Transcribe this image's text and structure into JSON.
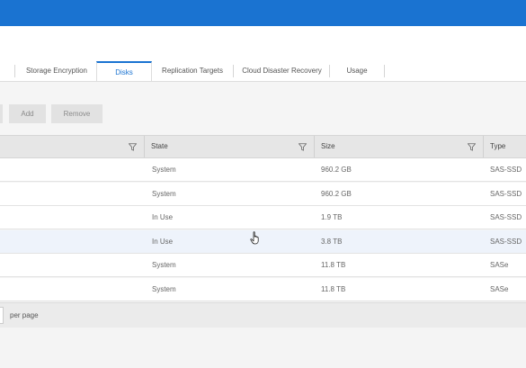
{
  "tabs": [
    {
      "label": "Storage Encryption",
      "active": false
    },
    {
      "label": "Disks",
      "active": true
    },
    {
      "label": "Replication Targets",
      "active": false
    },
    {
      "label": "Cloud Disaster Recovery",
      "active": false
    },
    {
      "label": "Usage",
      "active": false
    }
  ],
  "toolbar": {
    "add_label": "Add",
    "remove_label": "Remove"
  },
  "table": {
    "columns": [
      {
        "label": "",
        "filter_icon": "filter-icon"
      },
      {
        "label": "State",
        "filter_icon": "filter-icon"
      },
      {
        "label": "Size",
        "filter_icon": "filter-icon"
      },
      {
        "label": "Type"
      }
    ],
    "rows": [
      {
        "state": "System",
        "size": "960.2 GB",
        "type": "SAS-SSD"
      },
      {
        "state": "System",
        "size": "960.2 GB",
        "type": "SAS-SSD"
      },
      {
        "state": "In Use",
        "size": "1.9 TB",
        "type": "SAS-SSD"
      },
      {
        "state": "In Use",
        "size": "3.8 TB",
        "type": "SAS-SSD",
        "highlighted": true
      },
      {
        "state": "System",
        "size": "11.8 TB",
        "type": "SASe"
      },
      {
        "state": "System",
        "size": "11.8 TB",
        "type": "SASe"
      }
    ]
  },
  "footer": {
    "per_page_label": "per page"
  },
  "colors": {
    "accent": "#1a73d1",
    "header_bar": "#1a73d1"
  }
}
